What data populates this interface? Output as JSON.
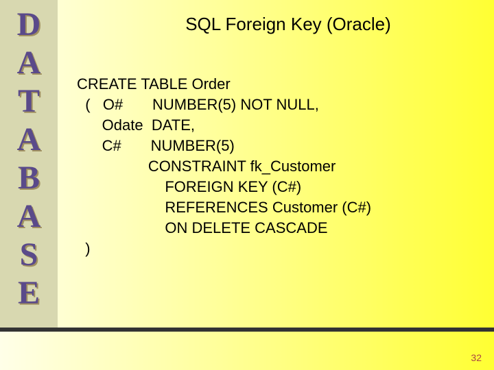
{
  "sidebar": {
    "letters": [
      "D",
      "A",
      "T",
      "A",
      "B",
      "A",
      "S",
      "E"
    ]
  },
  "title": "SQL Foreign Key (Oracle)",
  "code": {
    "l1": "CREATE TABLE Order",
    "l2": "  (   O#       NUMBER(5) NOT NULL,",
    "l3": "      Odate  DATE,",
    "l4": "      C#       NUMBER(5)",
    "l5": "                 CONSTRAINT fk_Customer",
    "l6": "                     FOREIGN KEY (C#)",
    "l7": "                     REFERENCES Customer (C#)",
    "l8": "                     ON DELETE CASCADE",
    "l9": "  )"
  },
  "page_number": "32"
}
